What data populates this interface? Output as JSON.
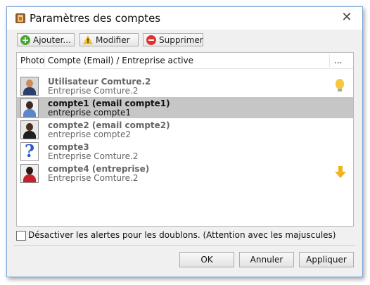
{
  "window": {
    "title": "Paramètres des comptes",
    "close_glyph": "✕"
  },
  "toolbar": {
    "add_label": "Ajouter...",
    "edit_label": "Modifier",
    "delete_label": "Supprimer"
  },
  "list": {
    "columns": {
      "photo": "Photo",
      "account": "Compte (Email) / Entreprise active",
      "more": "..."
    },
    "rows": [
      {
        "name": "Utilisateur Comture.2",
        "company": "Entreprise Comture.2",
        "status_icon": "lightbulb-icon"
      },
      {
        "name": "compte1 (email compte1)",
        "company": "entreprise compte1",
        "selected": true
      },
      {
        "name": "compte2 (email compte2)",
        "company": "entreprise compte2"
      },
      {
        "name": "compte3",
        "company": "Entreprise Comture.2",
        "photo_placeholder": "?"
      },
      {
        "name": "compte4 (entreprise)",
        "company": "Entreprise Comture.2",
        "status_icon": "arrow-down-icon"
      }
    ]
  },
  "options": {
    "duplicate_alerts_label": "Désactiver les alertes pour les doublons. (Attention avec les majuscules)",
    "duplicate_alerts_checked": false
  },
  "buttons": {
    "ok": "OK",
    "cancel": "Annuler",
    "apply": "Appliquer"
  },
  "colors": {
    "selected_row": "#c6c6c6",
    "window_border": "#7aa7d8"
  }
}
